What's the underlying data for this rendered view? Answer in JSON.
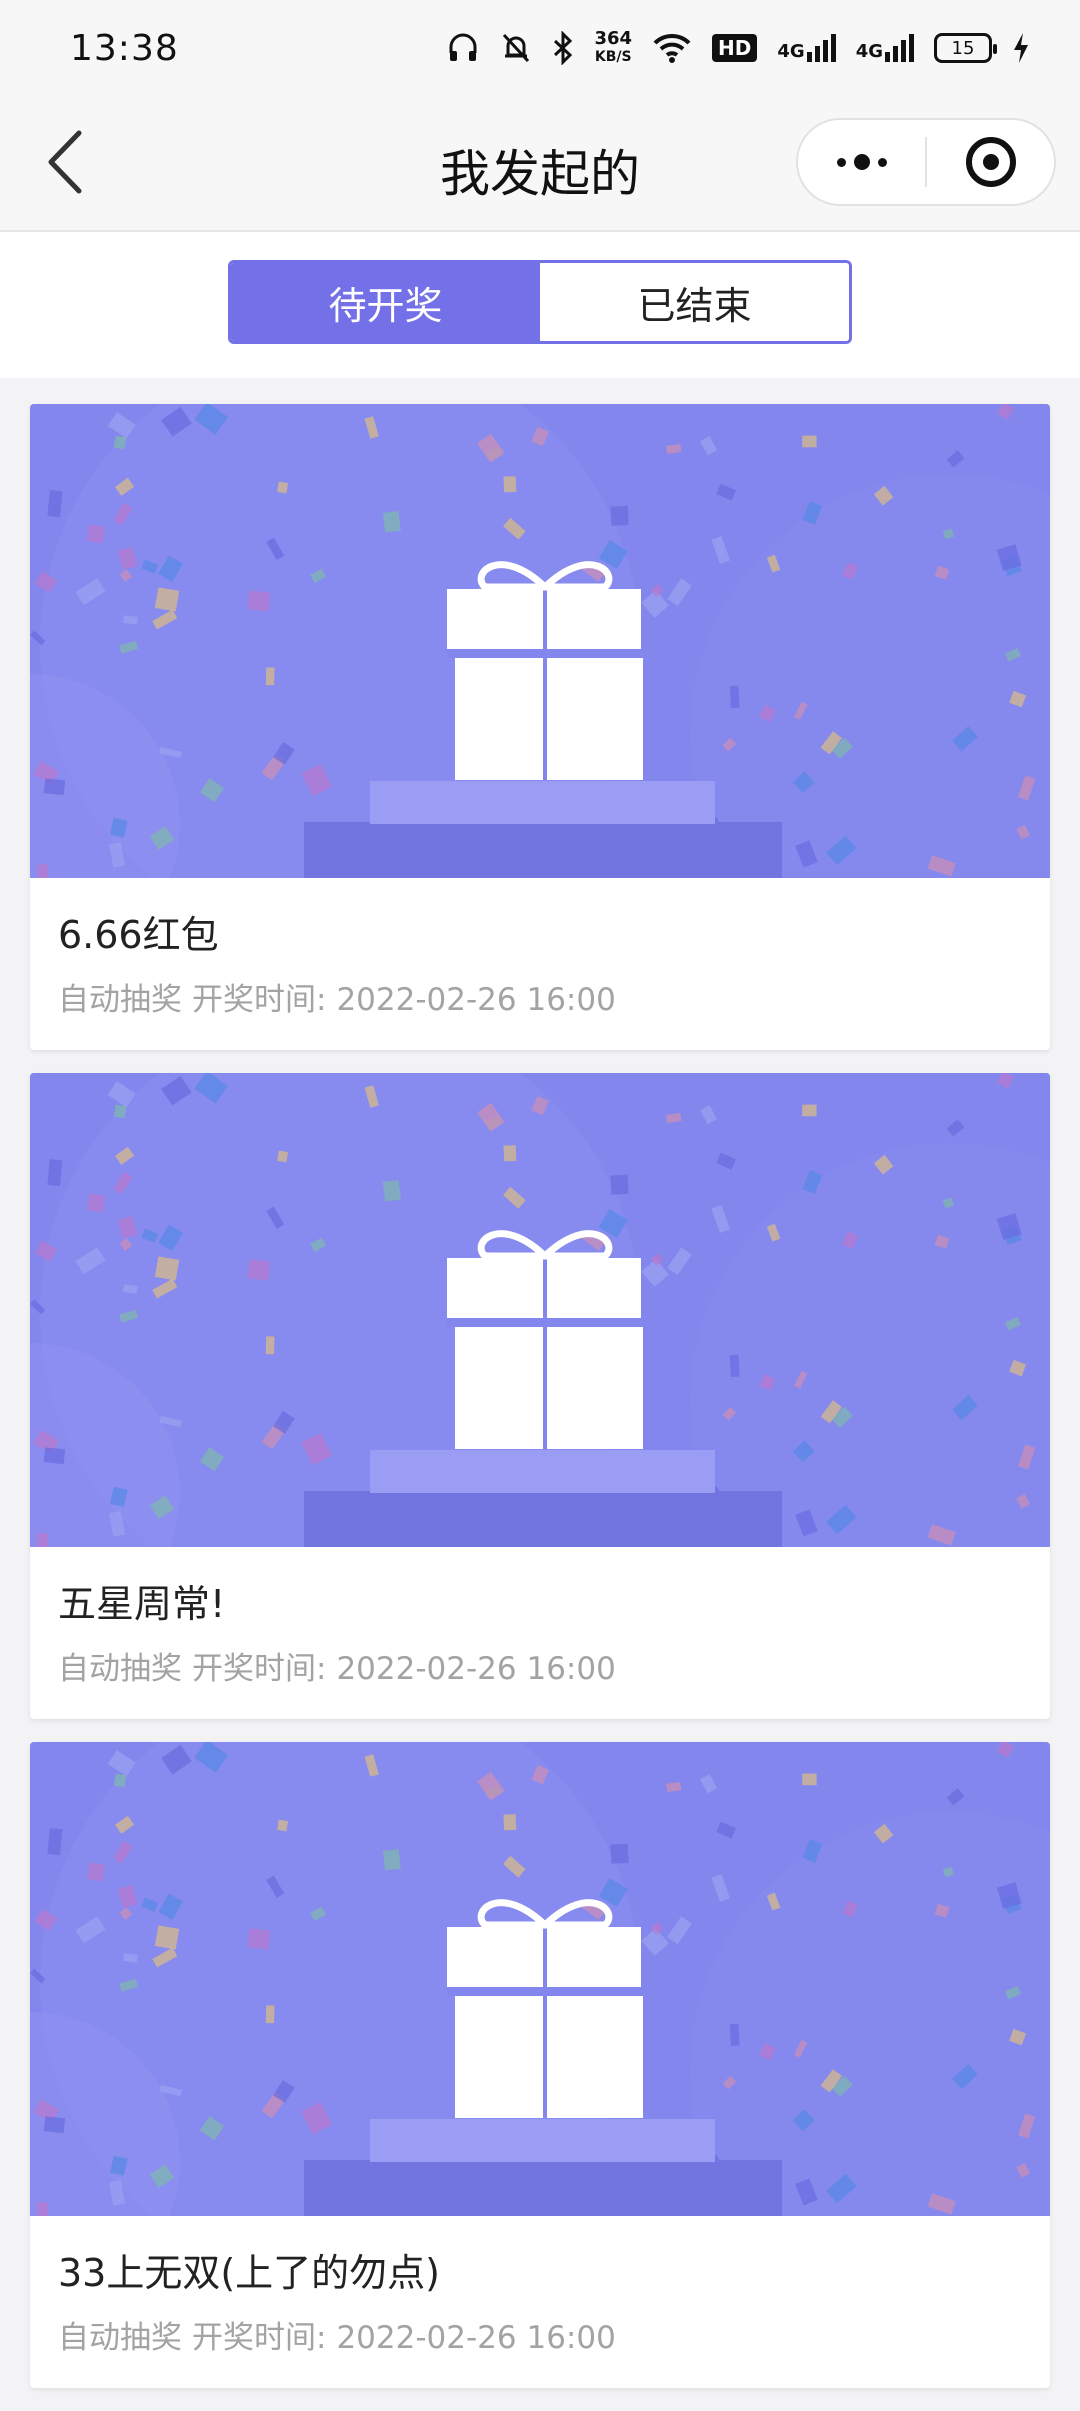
{
  "status_bar": {
    "time": "13:38",
    "speed_value": "364",
    "speed_unit": "KB/S",
    "hd_label": "HD",
    "net1": "4G",
    "net2": "4G",
    "battery": "15",
    "icons": [
      "headphones-icon",
      "bell-mute-icon",
      "bluetooth-icon",
      "wifi-icon",
      "charging-icon"
    ]
  },
  "header": {
    "title": "我发起的",
    "back_icon": "chevron-left-icon",
    "menu_icon": "more-dots-icon",
    "close_icon": "target-icon"
  },
  "tabs": [
    {
      "label": "待开奖",
      "active": true
    },
    {
      "label": "已结束",
      "active": false
    }
  ],
  "colors": {
    "accent": "#7470e8",
    "banner": "#8386ec",
    "meta_text": "#a3a3a3"
  },
  "cards": [
    {
      "title": "6.66红包",
      "mode": "自动抽奖",
      "time_label": "开奖时间:",
      "time": "2022-02-26 16:00",
      "image_icon": "gift-icon"
    },
    {
      "title": "五星周常!",
      "mode": "自动抽奖",
      "time_label": "开奖时间:",
      "time": "2022-02-26 16:00",
      "image_icon": "gift-icon"
    },
    {
      "title": "33上无双(上了的勿点)",
      "mode": "自动抽奖",
      "time_label": "开奖时间:",
      "time": "2022-02-26 16:00",
      "image_icon": "gift-icon"
    }
  ]
}
